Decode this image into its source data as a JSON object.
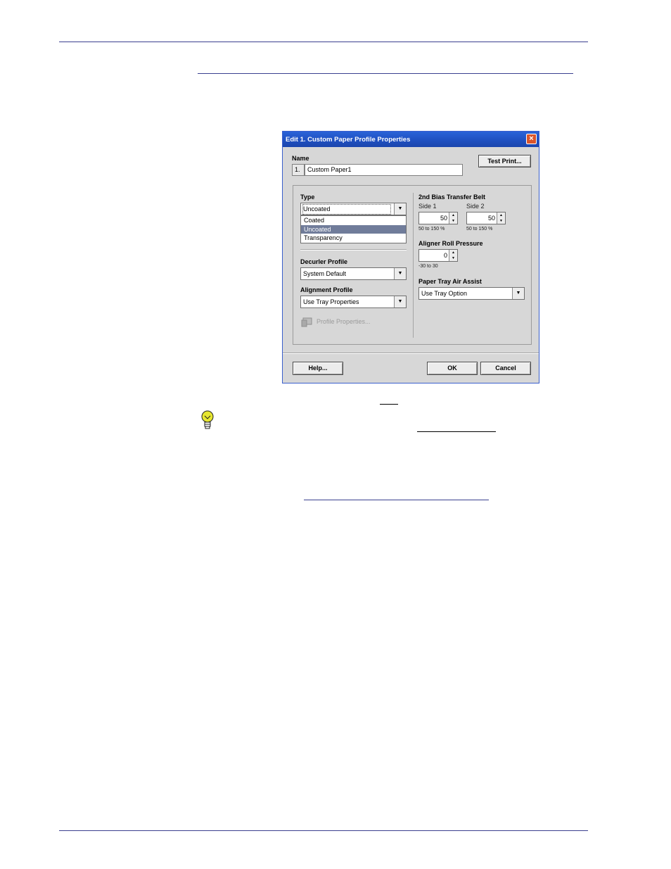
{
  "dialog": {
    "title": "Edit 1. Custom Paper Profile Properties",
    "close_glyph": "×",
    "name": {
      "label": "Name",
      "index": "1.",
      "value": "Custom Paper1"
    },
    "test_print_label": "Test Print...",
    "type": {
      "label": "Type",
      "value": "Uncoated",
      "options": [
        "Coated",
        "Uncoated",
        "Transparency"
      ]
    },
    "decurler": {
      "label": "Decurler Profile",
      "value": "System Default"
    },
    "alignment": {
      "label": "Alignment Profile",
      "value": "Use Tray Properties"
    },
    "profile_properties_label": "Profile Properties...",
    "bias_belt": {
      "label": "2nd Bias Transfer Belt",
      "side1": {
        "label": "Side 1",
        "value": "50",
        "range": "50 to 150 %"
      },
      "side2": {
        "label": "Side 2",
        "value": "50",
        "range": "50 to 150 %"
      }
    },
    "aligner": {
      "label": "Aligner Roll Pressure",
      "value": "0",
      "range": "-30 to 30"
    },
    "air_assist": {
      "label": "Paper Tray Air Assist",
      "value": "Use Tray Option"
    },
    "help_label": "Help...",
    "ok_label": "OK",
    "cancel_label": "Cancel"
  }
}
